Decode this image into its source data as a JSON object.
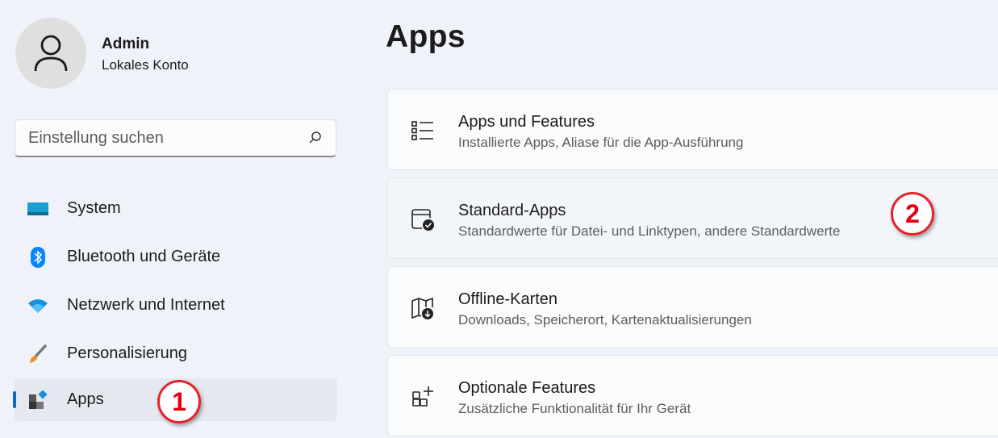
{
  "user": {
    "name": "Admin",
    "account": "Lokales Konto"
  },
  "search": {
    "placeholder": "Einstellung suchen"
  },
  "sidebar": {
    "items": [
      {
        "label": "System",
        "icon": "monitor-icon"
      },
      {
        "label": "Bluetooth und Geräte",
        "icon": "bluetooth-icon"
      },
      {
        "label": "Netzwerk und Internet",
        "icon": "wifi-icon"
      },
      {
        "label": "Personalisierung",
        "icon": "brush-icon"
      },
      {
        "label": "Apps",
        "icon": "apps-icon",
        "active": true
      }
    ]
  },
  "page": {
    "title": "Apps"
  },
  "cards": [
    {
      "title": "Apps und Features",
      "subtitle": "Installierte Apps, Aliase für die App-Ausführung",
      "icon": "list-icon"
    },
    {
      "title": "Standard-Apps",
      "subtitle": "Standardwerte für Datei- und Linktypen, andere Standardwerte",
      "icon": "default-apps-icon"
    },
    {
      "title": "Offline-Karten",
      "subtitle": "Downloads, Speicherort, Kartenaktualisierungen",
      "icon": "map-download-icon"
    },
    {
      "title": "Optionale Features",
      "subtitle": "Zusätzliche Funktionalität für Ihr Gerät",
      "icon": "add-apps-icon"
    }
  ],
  "annotations": {
    "step1": "1",
    "step2": "2"
  },
  "colors": {
    "accent": "#0f67c5",
    "badge": "#e3242b"
  }
}
